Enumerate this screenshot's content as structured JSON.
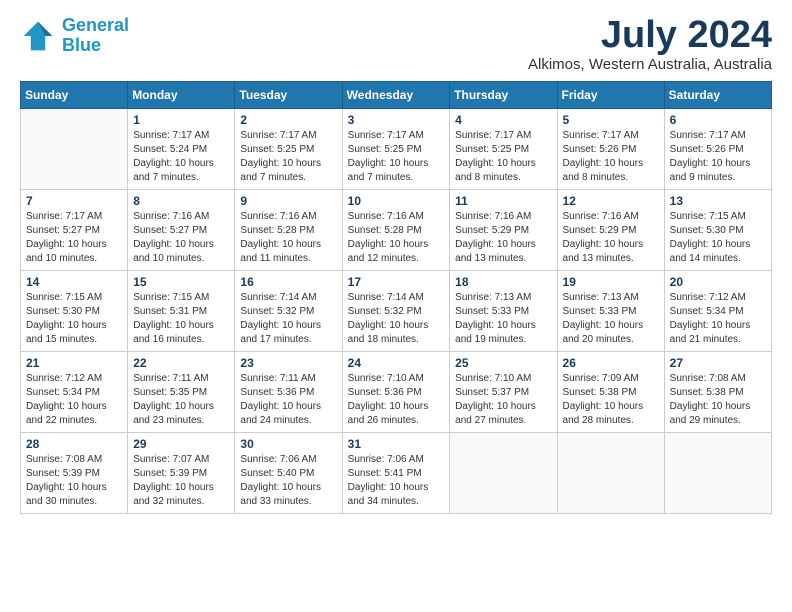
{
  "logo": {
    "line1": "General",
    "line2": "Blue"
  },
  "title": "July 2024",
  "location": "Alkimos, Western Australia, Australia",
  "days_of_week": [
    "Sunday",
    "Monday",
    "Tuesday",
    "Wednesday",
    "Thursday",
    "Friday",
    "Saturday"
  ],
  "weeks": [
    [
      {
        "num": "",
        "sunrise": "",
        "sunset": "",
        "daylight": ""
      },
      {
        "num": "1",
        "sunrise": "Sunrise: 7:17 AM",
        "sunset": "Sunset: 5:24 PM",
        "daylight": "Daylight: 10 hours and 7 minutes."
      },
      {
        "num": "2",
        "sunrise": "Sunrise: 7:17 AM",
        "sunset": "Sunset: 5:25 PM",
        "daylight": "Daylight: 10 hours and 7 minutes."
      },
      {
        "num": "3",
        "sunrise": "Sunrise: 7:17 AM",
        "sunset": "Sunset: 5:25 PM",
        "daylight": "Daylight: 10 hours and 7 minutes."
      },
      {
        "num": "4",
        "sunrise": "Sunrise: 7:17 AM",
        "sunset": "Sunset: 5:25 PM",
        "daylight": "Daylight: 10 hours and 8 minutes."
      },
      {
        "num": "5",
        "sunrise": "Sunrise: 7:17 AM",
        "sunset": "Sunset: 5:26 PM",
        "daylight": "Daylight: 10 hours and 8 minutes."
      },
      {
        "num": "6",
        "sunrise": "Sunrise: 7:17 AM",
        "sunset": "Sunset: 5:26 PM",
        "daylight": "Daylight: 10 hours and 9 minutes."
      }
    ],
    [
      {
        "num": "7",
        "sunrise": "Sunrise: 7:17 AM",
        "sunset": "Sunset: 5:27 PM",
        "daylight": "Daylight: 10 hours and 10 minutes."
      },
      {
        "num": "8",
        "sunrise": "Sunrise: 7:16 AM",
        "sunset": "Sunset: 5:27 PM",
        "daylight": "Daylight: 10 hours and 10 minutes."
      },
      {
        "num": "9",
        "sunrise": "Sunrise: 7:16 AM",
        "sunset": "Sunset: 5:28 PM",
        "daylight": "Daylight: 10 hours and 11 minutes."
      },
      {
        "num": "10",
        "sunrise": "Sunrise: 7:16 AM",
        "sunset": "Sunset: 5:28 PM",
        "daylight": "Daylight: 10 hours and 12 minutes."
      },
      {
        "num": "11",
        "sunrise": "Sunrise: 7:16 AM",
        "sunset": "Sunset: 5:29 PM",
        "daylight": "Daylight: 10 hours and 13 minutes."
      },
      {
        "num": "12",
        "sunrise": "Sunrise: 7:16 AM",
        "sunset": "Sunset: 5:29 PM",
        "daylight": "Daylight: 10 hours and 13 minutes."
      },
      {
        "num": "13",
        "sunrise": "Sunrise: 7:15 AM",
        "sunset": "Sunset: 5:30 PM",
        "daylight": "Daylight: 10 hours and 14 minutes."
      }
    ],
    [
      {
        "num": "14",
        "sunrise": "Sunrise: 7:15 AM",
        "sunset": "Sunset: 5:30 PM",
        "daylight": "Daylight: 10 hours and 15 minutes."
      },
      {
        "num": "15",
        "sunrise": "Sunrise: 7:15 AM",
        "sunset": "Sunset: 5:31 PM",
        "daylight": "Daylight: 10 hours and 16 minutes."
      },
      {
        "num": "16",
        "sunrise": "Sunrise: 7:14 AM",
        "sunset": "Sunset: 5:32 PM",
        "daylight": "Daylight: 10 hours and 17 minutes."
      },
      {
        "num": "17",
        "sunrise": "Sunrise: 7:14 AM",
        "sunset": "Sunset: 5:32 PM",
        "daylight": "Daylight: 10 hours and 18 minutes."
      },
      {
        "num": "18",
        "sunrise": "Sunrise: 7:13 AM",
        "sunset": "Sunset: 5:33 PM",
        "daylight": "Daylight: 10 hours and 19 minutes."
      },
      {
        "num": "19",
        "sunrise": "Sunrise: 7:13 AM",
        "sunset": "Sunset: 5:33 PM",
        "daylight": "Daylight: 10 hours and 20 minutes."
      },
      {
        "num": "20",
        "sunrise": "Sunrise: 7:12 AM",
        "sunset": "Sunset: 5:34 PM",
        "daylight": "Daylight: 10 hours and 21 minutes."
      }
    ],
    [
      {
        "num": "21",
        "sunrise": "Sunrise: 7:12 AM",
        "sunset": "Sunset: 5:34 PM",
        "daylight": "Daylight: 10 hours and 22 minutes."
      },
      {
        "num": "22",
        "sunrise": "Sunrise: 7:11 AM",
        "sunset": "Sunset: 5:35 PM",
        "daylight": "Daylight: 10 hours and 23 minutes."
      },
      {
        "num": "23",
        "sunrise": "Sunrise: 7:11 AM",
        "sunset": "Sunset: 5:36 PM",
        "daylight": "Daylight: 10 hours and 24 minutes."
      },
      {
        "num": "24",
        "sunrise": "Sunrise: 7:10 AM",
        "sunset": "Sunset: 5:36 PM",
        "daylight": "Daylight: 10 hours and 26 minutes."
      },
      {
        "num": "25",
        "sunrise": "Sunrise: 7:10 AM",
        "sunset": "Sunset: 5:37 PM",
        "daylight": "Daylight: 10 hours and 27 minutes."
      },
      {
        "num": "26",
        "sunrise": "Sunrise: 7:09 AM",
        "sunset": "Sunset: 5:38 PM",
        "daylight": "Daylight: 10 hours and 28 minutes."
      },
      {
        "num": "27",
        "sunrise": "Sunrise: 7:08 AM",
        "sunset": "Sunset: 5:38 PM",
        "daylight": "Daylight: 10 hours and 29 minutes."
      }
    ],
    [
      {
        "num": "28",
        "sunrise": "Sunrise: 7:08 AM",
        "sunset": "Sunset: 5:39 PM",
        "daylight": "Daylight: 10 hours and 30 minutes."
      },
      {
        "num": "29",
        "sunrise": "Sunrise: 7:07 AM",
        "sunset": "Sunset: 5:39 PM",
        "daylight": "Daylight: 10 hours and 32 minutes."
      },
      {
        "num": "30",
        "sunrise": "Sunrise: 7:06 AM",
        "sunset": "Sunset: 5:40 PM",
        "daylight": "Daylight: 10 hours and 33 minutes."
      },
      {
        "num": "31",
        "sunrise": "Sunrise: 7:06 AM",
        "sunset": "Sunset: 5:41 PM",
        "daylight": "Daylight: 10 hours and 34 minutes."
      },
      {
        "num": "",
        "sunrise": "",
        "sunset": "",
        "daylight": ""
      },
      {
        "num": "",
        "sunrise": "",
        "sunset": "",
        "daylight": ""
      },
      {
        "num": "",
        "sunrise": "",
        "sunset": "",
        "daylight": ""
      }
    ]
  ]
}
